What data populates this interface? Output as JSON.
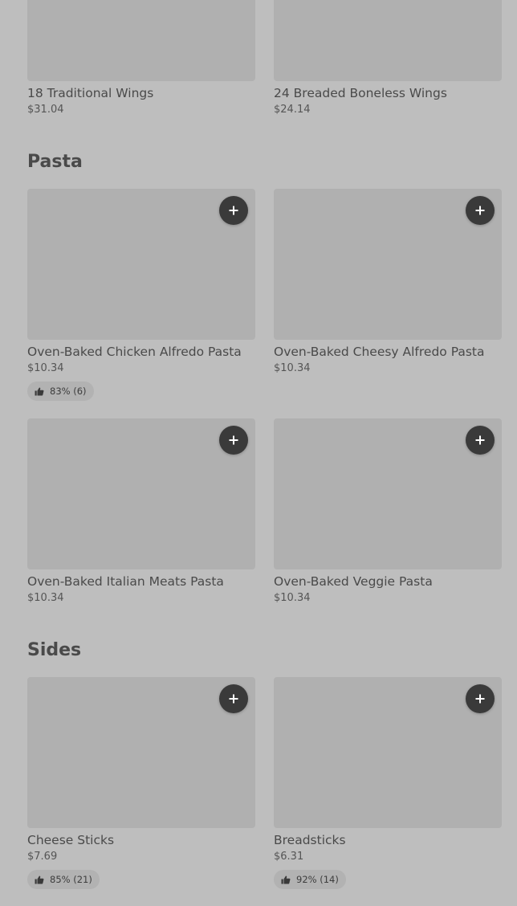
{
  "sections": [
    {
      "title": "",
      "items": [
        {
          "name": "18 Traditional Wings",
          "price": "$31.04"
        },
        {
          "name": "24 Breaded Boneless Wings",
          "price": "$24.14"
        }
      ]
    },
    {
      "title": "Pasta",
      "items": [
        {
          "name": "Oven-Baked Chicken Alfredo Pasta",
          "price": "$10.34",
          "rating": "83% (6)"
        },
        {
          "name": "Oven-Baked Cheesy Alfredo Pasta",
          "price": "$10.34"
        },
        {
          "name": "Oven-Baked Italian Meats Pasta",
          "price": "$10.34"
        },
        {
          "name": "Oven-Baked Veggie Pasta",
          "price": "$10.34"
        }
      ]
    },
    {
      "title": "Sides",
      "items": [
        {
          "name": "Cheese Sticks",
          "price": "$7.69",
          "rating": "85% (21)"
        },
        {
          "name": "Breadsticks",
          "price": "$6.31",
          "rating": "92% (14)"
        }
      ]
    }
  ],
  "icons": {
    "add": "plus-icon",
    "rating": "thumbs-up-icon"
  },
  "colors": {
    "background": "#bebebe",
    "image_placeholder": "#b0b0b0",
    "add_button": "#3a3a3a",
    "rating_pill": "#b2b2b2"
  }
}
